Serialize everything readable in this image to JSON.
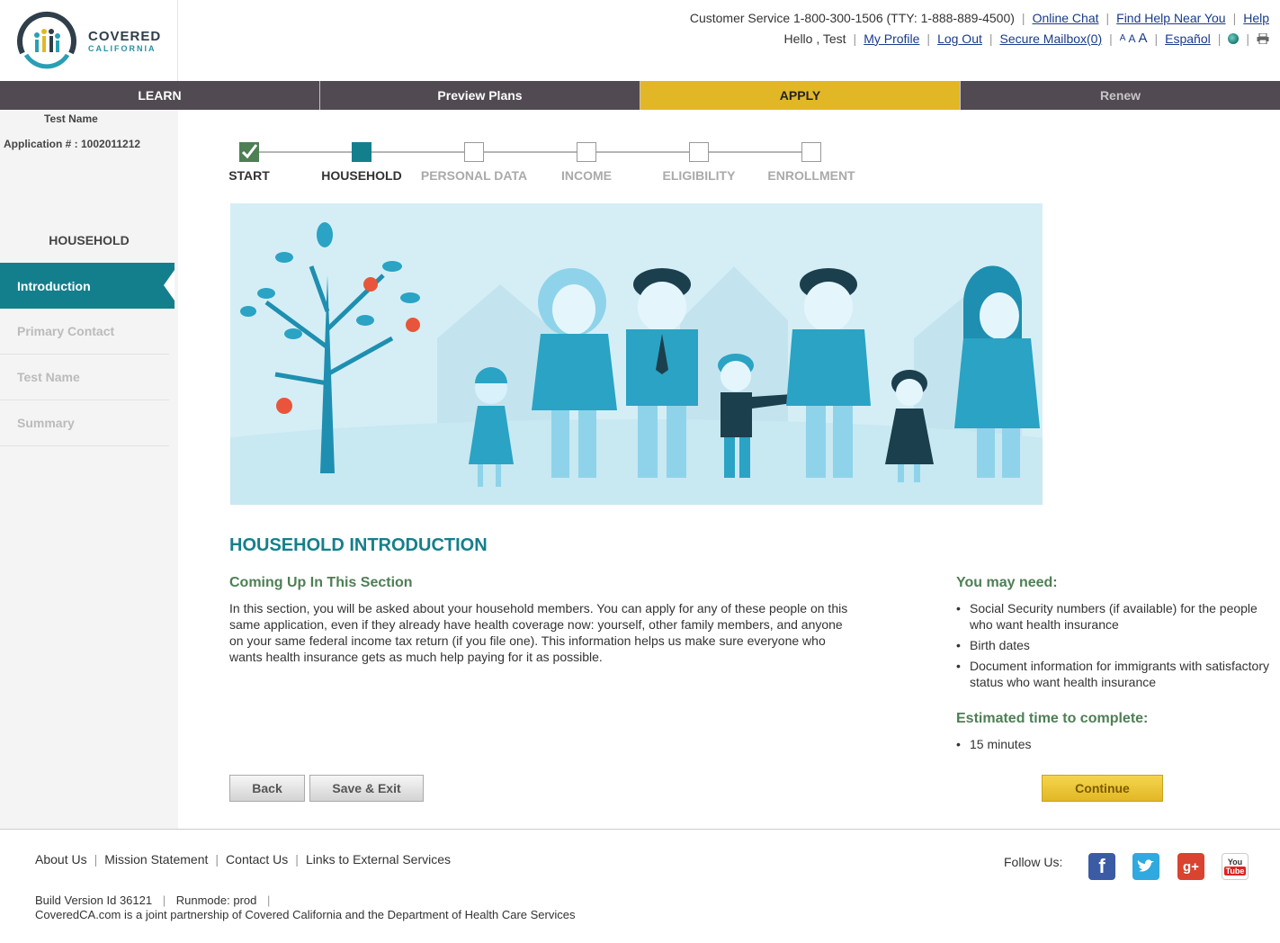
{
  "logo": {
    "line1": "COVERED",
    "line2": "CALIFORNIA"
  },
  "topbar": {
    "customer_service": "Customer Service 1-800-300-1506 (TTY: 1-888-889-4500)",
    "online_chat": "Online Chat",
    "find_help": "Find Help Near You",
    "help": "Help",
    "greeting": "Hello , Test",
    "my_profile": "My Profile",
    "log_out": "Log Out",
    "secure_mailbox": "Secure Mailbox(0)",
    "font_small": "A",
    "font_medium": "A",
    "font_large": "A",
    "espanol": "Español"
  },
  "nav": {
    "tabs": [
      "LEARN",
      "Preview Plans",
      "APPLY",
      "Renew"
    ],
    "active": "APPLY"
  },
  "sidebar": {
    "name": "Test Name",
    "application": "Application # : 1002011212",
    "section": "HOUSEHOLD",
    "items": [
      "Introduction",
      "Primary Contact",
      "Test Name",
      "Summary"
    ]
  },
  "stepper": {
    "steps": [
      "START",
      "HOUSEHOLD",
      "PERSONAL DATA",
      "INCOME",
      "ELIGIBILITY",
      "ENROLLMENT"
    ],
    "completed": [
      "START"
    ],
    "current": "HOUSEHOLD"
  },
  "content": {
    "title": "HOUSEHOLD INTRODUCTION",
    "section_title": "Coming Up In This Section",
    "body": "In this section, you will be asked about your household members. You can apply for any of these people on this same application, even if they already have health coverage now: yourself, other family members, and anyone on your same federal income tax return (if you file one). This information helps us make sure everyone who wants health insurance gets as much help paying for it as possible.",
    "need_title": "You may need:",
    "need_items": [
      "Social Security numbers (if available) for the people who want health insurance",
      "Birth dates",
      "Document information for immigrants with satisfactory status who want health insurance"
    ],
    "est_title": "Estimated time to complete:",
    "est_items": [
      "15 minutes"
    ]
  },
  "buttons": {
    "back": "Back",
    "save_exit": "Save & Exit",
    "continue": "Continue"
  },
  "footer": {
    "links": [
      "About Us",
      "Mission Statement",
      "Contact Us",
      "Links to External Services"
    ],
    "build": "Build Version Id 36121",
    "runmode": "Runmode: prod",
    "partner": "CoveredCA.com is a joint partnership of Covered California and the Department of Health Care Services",
    "follow": "Follow Us:",
    "social": {
      "facebook": "f",
      "google": "g+",
      "youtube_top": "You",
      "youtube_bottom": "Tube"
    }
  },
  "colors": {
    "teal": "#147f8c",
    "gold": "#e2b726",
    "nav": "#514a52",
    "green": "#4e7f55"
  }
}
